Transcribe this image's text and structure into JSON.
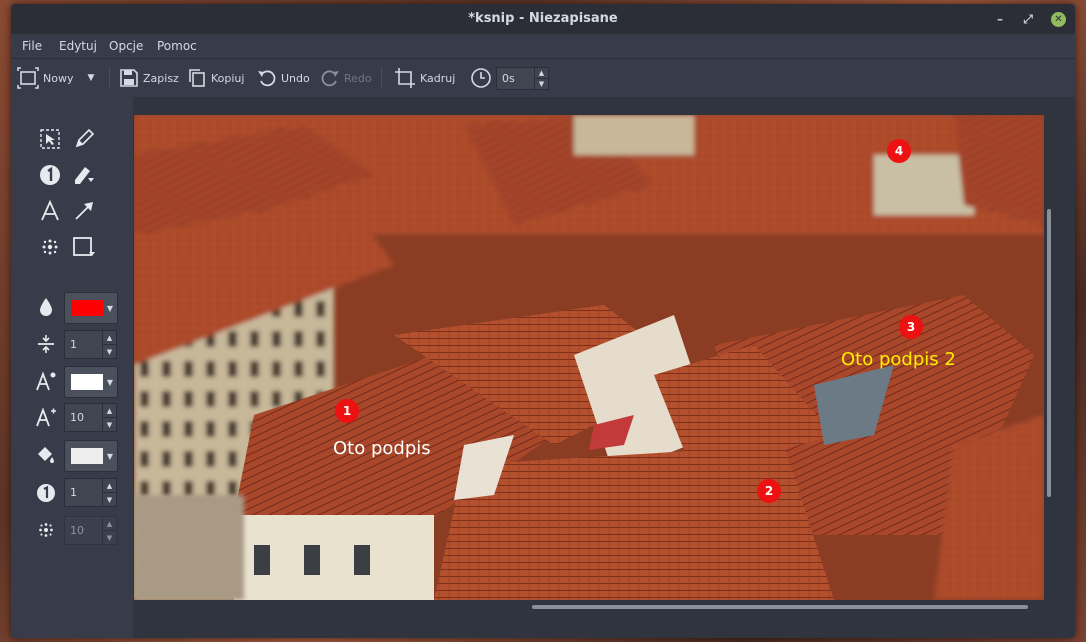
{
  "window": {
    "title": "*ksnip - Niezapisane",
    "controls": {
      "minimize": "–",
      "maximize": "⤢",
      "close": "✕"
    }
  },
  "menu": {
    "items": [
      "File",
      "Edytuj",
      "Opcje",
      "Pomoc"
    ]
  },
  "toolbar": {
    "new_label": "Nowy",
    "save_label": "Zapisz",
    "copy_label": "Kopiuj",
    "undo_label": "Undo",
    "redo_label": "Redo",
    "crop_label": "Kadruj",
    "delay_value": "0s"
  },
  "sidebar": {
    "color": "#ff0000",
    "stroke_width": "1",
    "font_color": "#ffffff",
    "font_size": "10",
    "fill_color": "#eeeeee",
    "number_value": "1",
    "blur_value": "10"
  },
  "canvas": {
    "markers": [
      "1",
      "2",
      "3",
      "4"
    ],
    "captions": [
      {
        "text": "Oto podpis",
        "color": "#ffffff"
      },
      {
        "text": "Oto podpis 2",
        "color": "#ffee00"
      }
    ]
  }
}
